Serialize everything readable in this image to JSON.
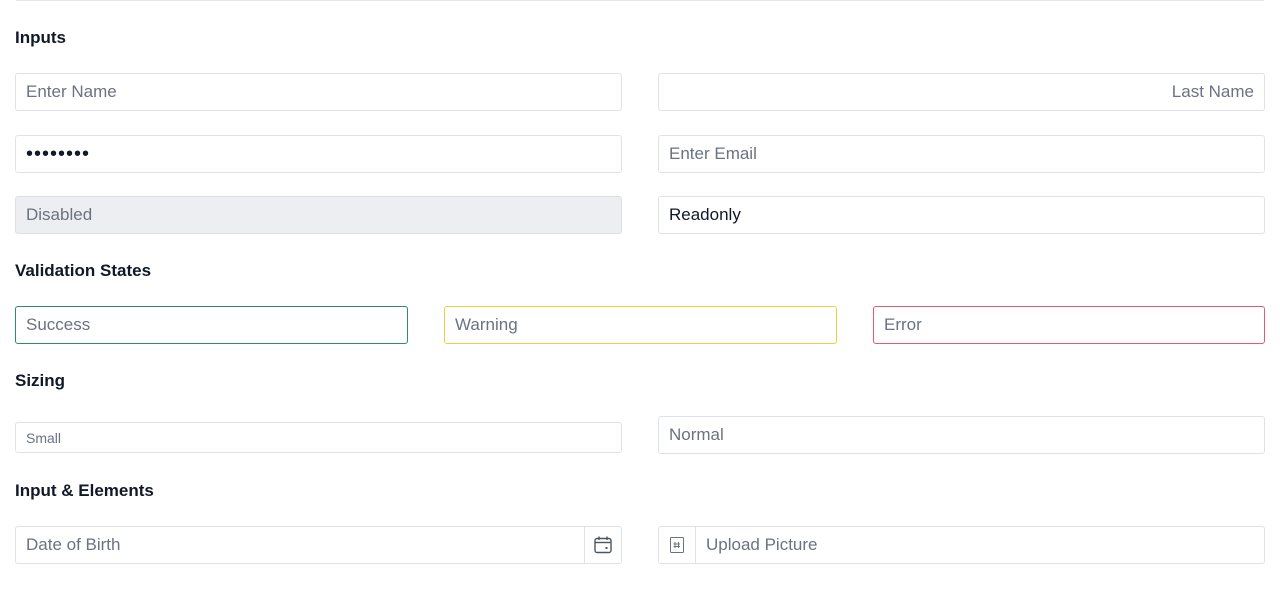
{
  "sections": {
    "inputs": "Inputs",
    "validation": "Validation States",
    "sizing": "Sizing",
    "elements": "Input & Elements"
  },
  "inputs": {
    "first_name_placeholder": "Enter Name",
    "last_name_placeholder": "Last Name",
    "password_value": "••••••••",
    "email_placeholder": "Enter Email",
    "disabled_placeholder": "Disabled",
    "readonly_value": "Readonly"
  },
  "validation": {
    "success_placeholder": "Success",
    "warning_placeholder": "Warning",
    "error_placeholder": "Error",
    "colors": {
      "success": "#2f8a6e",
      "warning": "#f3cd3f",
      "error": "#e35b6d"
    }
  },
  "sizing": {
    "small_placeholder": "Small",
    "normal_placeholder": "Normal"
  },
  "elements": {
    "dob_placeholder": "Date of Birth",
    "dob_icon": "calendar-icon",
    "upload_placeholder": "Upload Picture",
    "upload_icon": "image-file-icon"
  }
}
